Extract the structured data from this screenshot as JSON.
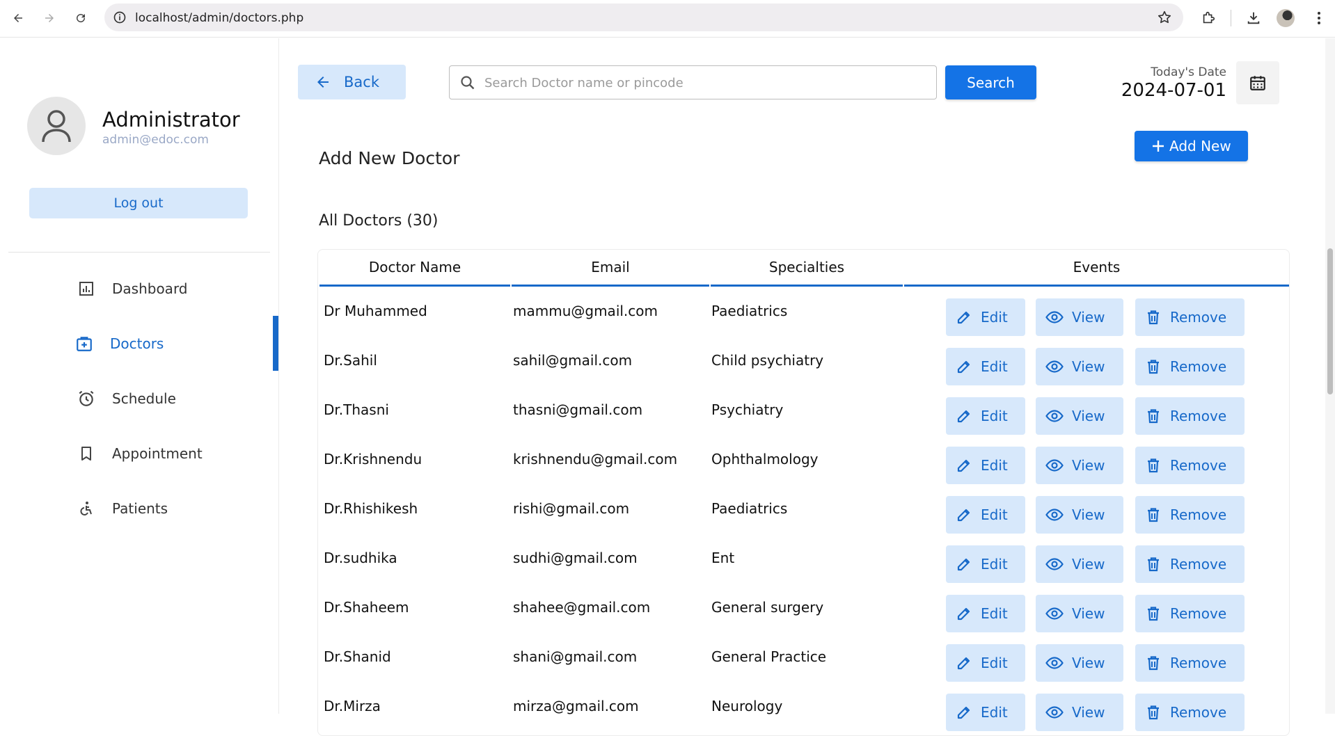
{
  "browser": {
    "url": "localhost/admin/doctors.php"
  },
  "sidebar": {
    "profile": {
      "name": "Administrator",
      "email": "admin@edoc.com"
    },
    "logout_label": "Log out",
    "items": [
      {
        "label": "Dashboard",
        "icon": "dashboard-icon"
      },
      {
        "label": "Doctors",
        "icon": "doctors-icon",
        "active": true
      },
      {
        "label": "Schedule",
        "icon": "schedule-icon"
      },
      {
        "label": "Appointment",
        "icon": "bookmark-icon"
      },
      {
        "label": "Patients",
        "icon": "patients-icon"
      }
    ]
  },
  "header": {
    "back_label": "Back",
    "search_placeholder": "Search Doctor name or pincode",
    "search_value": "",
    "search_label": "Search",
    "date_label": "Today's Date",
    "date_value": "2024-07-01"
  },
  "main": {
    "add_title": "Add New Doctor",
    "add_new_label": "Add New",
    "list_title": "All Doctors (30)"
  },
  "table": {
    "columns": [
      "Doctor Name",
      "Email",
      "Specialties",
      "Events"
    ],
    "actions": {
      "edit": "Edit",
      "view": "View",
      "remove": "Remove"
    },
    "rows": [
      {
        "name": "Dr Muhammed",
        "email": "mammu@gmail.com",
        "specialty": "Paediatrics"
      },
      {
        "name": "Dr.Sahil",
        "email": "sahil@gmail.com",
        "specialty": "Child psychiatry"
      },
      {
        "name": "Dr.Thasni",
        "email": "thasni@gmail.com",
        "specialty": "Psychiatry"
      },
      {
        "name": "Dr.Krishnendu",
        "email": "krishnendu@gmail.com",
        "specialty": "Ophthalmology"
      },
      {
        "name": "Dr.Rhishikesh",
        "email": "rishi@gmail.com",
        "specialty": "Paediatrics"
      },
      {
        "name": "Dr.sudhika",
        "email": "sudhi@gmail.com",
        "specialty": "Ent"
      },
      {
        "name": "Dr.Shaheem",
        "email": "shahee@gmail.com",
        "specialty": "General surgery"
      },
      {
        "name": "Dr.Shanid",
        "email": "shani@gmail.com",
        "specialty": "General Practice"
      },
      {
        "name": "Dr.Mirza",
        "email": "mirza@gmail.com",
        "specialty": "Neurology"
      }
    ]
  },
  "colors": {
    "accent": "#1769c9",
    "accent_light": "#d7e8fb",
    "primary_button": "#1473e6"
  }
}
